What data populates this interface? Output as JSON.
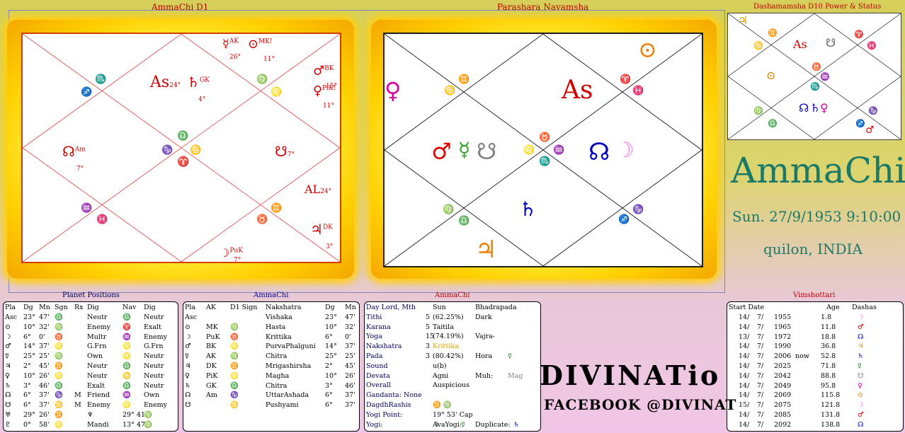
{
  "charts": {
    "d1_title": "AmmaChi D1",
    "navamsha_title": "Parashara Navamsha",
    "d10_title": "Dashamamsha D10 Power & Status",
    "d1": {
      "top_planets_1": "☿",
      "top_planets_1_sup": "AK",
      "top_planets_1_deg": "26°",
      "top_planets_2": "⊙",
      "top_planets_2_sup": "MK!",
      "top_planets_2_deg": "11°",
      "mars": "♂",
      "mars_sup": "BK",
      "mars_deg": "15°",
      "venus": "♀",
      "venus_sup": "PiK!",
      "venus_deg": "11°",
      "as": "As",
      "as_deg": "24°",
      "saturn": "♄",
      "saturn_sup": "GK",
      "saturn_deg": "4°",
      "rahu": "☊",
      "rahu_sup": "Am",
      "rahu_deg": "7°",
      "ketu": "☋",
      "ketu_deg": "7°",
      "al": "AL",
      "al_deg": "24°",
      "jupiter": "♃",
      "jupiter_sup": "DK",
      "jupiter_deg": "3°",
      "moon": "☽",
      "moon_sup": "PuK",
      "moon_deg": "7°",
      "signs": {
        "s1": "♐",
        "s2": "♏",
        "s3": "♍",
        "s4": "♌",
        "s5": "♑",
        "s6": "♎",
        "s7": "♋",
        "s8": "♈",
        "s9": "♒",
        "s10": "♓",
        "s11": "♉",
        "s12": "♊"
      }
    },
    "navamsha": {
      "venus": "♀",
      "sun": "⊙",
      "as": "As",
      "mars": "♂",
      "mercury": "☿",
      "ketu": "☋",
      "rahu": "☊",
      "moon": "☽",
      "saturn": "♄",
      "jupiter": "♃",
      "signs": {
        "s1": "♊",
        "s2": "♋",
        "s3": "♈",
        "s4": "♓",
        "s5": "♉",
        "s6": "♌",
        "s7": "♒",
        "s8": "♏",
        "s9": "♍",
        "s10": "♎",
        "s11": "♑",
        "s12": "♐"
      }
    },
    "d10": {
      "jupiter": "♃",
      "as": "As",
      "ketu": "☋",
      "sun": "⊙",
      "rahu": "☊",
      "saturn": "♄",
      "venus": "♀",
      "mars": "♂",
      "signs": {
        "s1": "♊",
        "s2": "♋",
        "s3": "♈",
        "s4": "♓",
        "s5": "♉",
        "s6": "♒",
        "s7": "♏",
        "s8": "♍",
        "s9": "♑",
        "s10": "♎",
        "s11": "♐"
      }
    }
  },
  "person": {
    "name": "AmmaChi",
    "datetime": "Sun. 27/9/1953  9:10:00",
    "place": "quilon, INDIA"
  },
  "logo": {
    "main": "DIVINATio",
    "sub": "FACEBOOK @DIVINAT"
  },
  "planet_positions": {
    "title": "Planet Positions",
    "headers": [
      "Pla",
      "Dg",
      "Mn",
      "Sgn",
      "Rx",
      "Dig",
      "Nav",
      "Dig"
    ],
    "rows": [
      [
        "Asc",
        "23°",
        "47'",
        "♎",
        "",
        "Neutr",
        "♎",
        "Neutr"
      ],
      [
        "⊙",
        "10°",
        "32'",
        "♍",
        "",
        "Enemy",
        "♈",
        "Exalt"
      ],
      [
        "☽",
        "6°",
        "0'",
        "♉",
        "",
        "Multr",
        "♒",
        "Enemy"
      ],
      [
        "♂",
        "14°",
        "37'",
        "♌",
        "",
        "G.Frn",
        "♌",
        "G.Frn"
      ],
      [
        "☿",
        "25°",
        "25'",
        "♍",
        "",
        "Own",
        "♌",
        "Neutr"
      ],
      [
        "♃",
        "2°",
        "45'",
        "♊",
        "",
        "Neutr",
        "♎",
        "Neutr"
      ],
      [
        "♀",
        "10°",
        "26'",
        "♌",
        "",
        "Neutr",
        "♋",
        "Neutr"
      ],
      [
        "♄",
        "3°",
        "46'",
        "♎",
        "",
        "Exalt",
        "♎",
        "Neutr"
      ],
      [
        "☊",
        "6°",
        "37'",
        "♑",
        "M",
        "Friend",
        "♒",
        "Own"
      ],
      [
        "☋",
        "6°",
        "37'",
        "♋",
        "M",
        "Enemy",
        "♌",
        "Enemy"
      ],
      [
        "♅",
        "29°",
        "26'",
        "♊",
        "",
        "♆",
        "29° 41'",
        "♍"
      ],
      [
        "♇",
        "0°",
        "58'",
        "♌",
        "",
        "Mandi",
        "13° 47'",
        "♍"
      ]
    ]
  },
  "karakas": {
    "title": "AmmaChi",
    "headers": [
      "Pla",
      "AK",
      "D1 Sign",
      "Nakshatra",
      "Dg",
      "Mn"
    ],
    "rows": [
      [
        "Asc",
        "",
        "",
        "Vishaka",
        "23°",
        "47'"
      ],
      [
        "⊙",
        "MK",
        "♍",
        "Hasta",
        "10°",
        "32'"
      ],
      [
        "☽",
        "PuK",
        "♉",
        "Krittika",
        "6°",
        "0'"
      ],
      [
        "♂",
        "BK",
        "♌",
        "PurvaPhalguni",
        "14°",
        "37'"
      ],
      [
        "☿",
        "AK",
        "♍",
        "Chitra",
        "25°",
        "25'"
      ],
      [
        "♃",
        "DK",
        "♊",
        "Mrigashirsha",
        "2°",
        "45'"
      ],
      [
        "♀",
        "PiK",
        "♌",
        "Magha",
        "10°",
        "26'"
      ],
      [
        "♄",
        "GK",
        "♎",
        "Chitra",
        "3°",
        "46'"
      ],
      [
        "☊",
        "Am",
        "♑",
        "UttarAshada",
        "6°",
        "37'"
      ],
      [
        "☋",
        "",
        "♋",
        "Pushyami",
        "6°",
        "37'"
      ]
    ]
  },
  "panchang": {
    "title": "AmmaChi",
    "rows": [
      {
        "label": "Day Lord, Mth",
        "num": "",
        "val": "Sun",
        "extra": "Bhadrapada"
      },
      {
        "label": "Tithi",
        "num": "5",
        "val": "(62.25%)",
        "extra": "Dark"
      },
      {
        "label": "Karana",
        "num": "5",
        "val": "Taitila",
        "extra": ""
      },
      {
        "label": "Yoga",
        "num": "15",
        "val": "(74.19%)",
        "extra": "Vajra-"
      },
      {
        "label": "Nakshatra",
        "num": "3",
        "val": "Krittika",
        "extra": ""
      },
      {
        "label": "Pada",
        "num": "3",
        "val": "(80.42%)",
        "extra": "Hora"
      },
      {
        "label": "Sound",
        "num": "",
        "val": "u(b)",
        "extra": ""
      },
      {
        "label": "Devata",
        "num": "",
        "val": "Agni",
        "extra": "Muh:"
      },
      {
        "label": "Overall",
        "num": "",
        "val": "Auspicious",
        "extra": ""
      },
      {
        "label": "Gandanta: None",
        "num": "",
        "val": "",
        "extra": ""
      },
      {
        "label": "DagdhRashis",
        "num": "",
        "val": "♊  ♍",
        "extra": ""
      },
      {
        "label": "Yogi Point:",
        "num": "",
        "val": "19° 53' Cap",
        "extra": ""
      },
      {
        "label": "Yogi:",
        "num": "",
        "val": "☽",
        "extra": ""
      }
    ],
    "hora_symbol": "☿",
    "muh_value": "Mag",
    "avayogi_label": "AvaYogi:",
    "avayogi_symbol": "☿",
    "duplicate_label": "Duplicate:",
    "duplicate_symbol": "♄"
  },
  "vimshottari": {
    "title": "Vimshottari",
    "headers": [
      "Start Date",
      "Age",
      "Dashas"
    ],
    "rows": [
      [
        "14/",
        "7/",
        "1955",
        "",
        "1.8",
        "☽"
      ],
      [
        "14/",
        "7/",
        "1965",
        "",
        "11.8",
        "♂"
      ],
      [
        "13/",
        "7/",
        "1972",
        "",
        "18.8",
        "☊"
      ],
      [
        "14/",
        "7/",
        "1990",
        "",
        "36.8",
        "♃"
      ],
      [
        "14/",
        "7/",
        "2006",
        "now",
        "52.8",
        "♄"
      ],
      [
        "14/",
        "7/",
        "2025",
        "",
        "71.8",
        "☿"
      ],
      [
        "14/",
        "7/",
        "2042",
        "",
        "88.8",
        "☋"
      ],
      [
        "14/",
        "7/",
        "2049",
        "",
        "95.8",
        "♀"
      ],
      [
        "14/",
        "7/",
        "2069",
        "",
        "115.8",
        "⊙"
      ],
      [
        "15/",
        "7/",
        "2075",
        "",
        "121.8",
        "☽"
      ],
      [
        "14/",
        "7/",
        "2085",
        "",
        "131.8",
        "♂"
      ],
      [
        "14/",
        "7/",
        "2092",
        "",
        "138.8",
        "☊"
      ]
    ]
  },
  "colors": {
    "red": "#d00000",
    "teal": "#1a7a6a",
    "navy": "#000060",
    "gold": "#ffd000"
  }
}
